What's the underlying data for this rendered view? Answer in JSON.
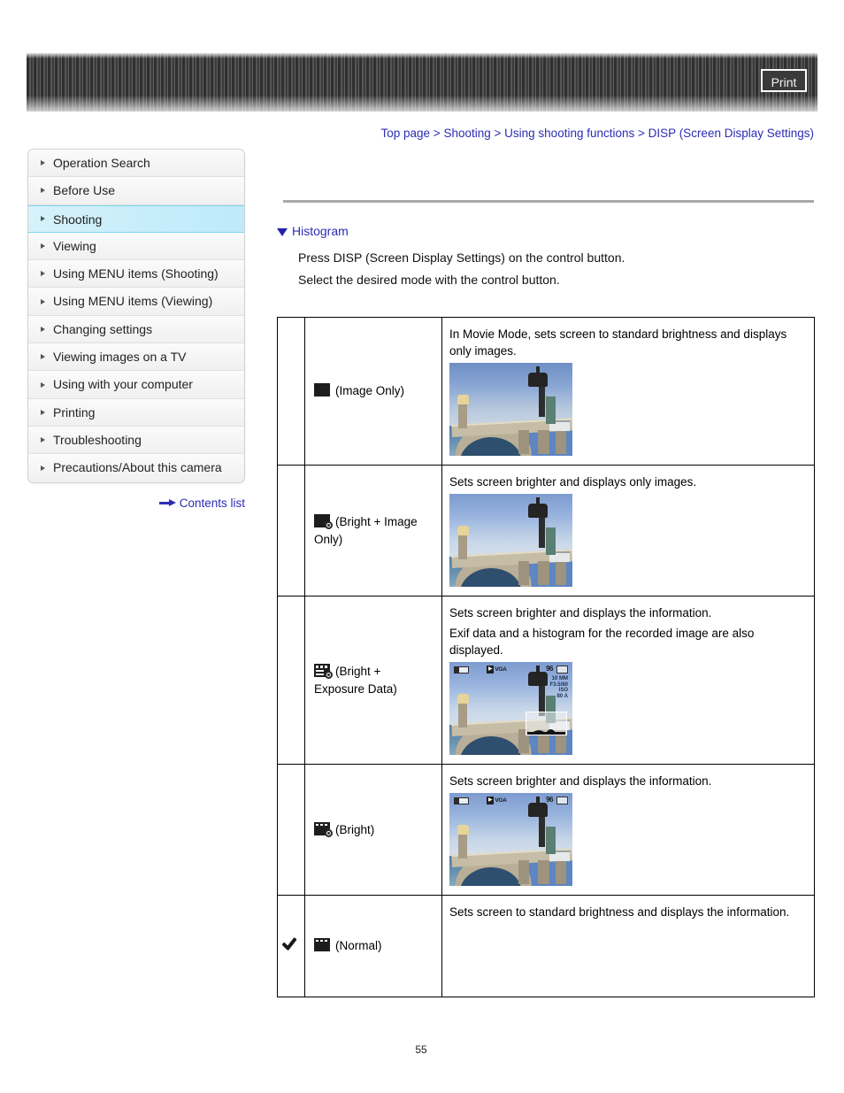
{
  "header": {
    "print_label": "Print"
  },
  "breadcrumb": {
    "items": [
      "Top page",
      "Shooting",
      "Using shooting functions",
      "DISP (Screen Display Settings)"
    ],
    "separator": ">"
  },
  "sidebar": {
    "items": [
      {
        "label": "Operation Search",
        "active": false
      },
      {
        "label": "Before Use",
        "active": false
      },
      {
        "label": "Shooting",
        "active": true
      },
      {
        "label": "Viewing",
        "active": false
      },
      {
        "label": "Using MENU items (Shooting)",
        "active": false
      },
      {
        "label": "Using MENU items (Viewing)",
        "active": false
      },
      {
        "label": "Changing settings",
        "active": false
      },
      {
        "label": "Viewing images on a TV",
        "active": false
      },
      {
        "label": "Using with your computer",
        "active": false
      },
      {
        "label": "Printing",
        "active": false
      },
      {
        "label": "Troubleshooting",
        "active": false
      },
      {
        "label": "Precautions/About this camera",
        "active": false
      }
    ],
    "contents_list_label": "Contents list"
  },
  "main": {
    "section_title": "Histogram",
    "instruction_1": "Press DISP (Screen Display Settings) on the control button.",
    "instruction_2": "Select the desired mode with the control button.",
    "rows": [
      {
        "checked": "",
        "mode_label": "(Image Only)",
        "icon": "screen-plain-icon",
        "description_lines": [
          "In Movie Mode, sets screen to standard brightness and displays only images."
        ],
        "photo": {
          "bright": false,
          "overlay": false,
          "histogram": false
        }
      },
      {
        "checked": "",
        "mode_label": "(Bright + Image Only)",
        "icon": "screen-plain-bright-icon",
        "description_lines": [
          "Sets screen brighter and displays only images."
        ],
        "photo": {
          "bright": true,
          "overlay": false,
          "histogram": false
        }
      },
      {
        "checked": "",
        "mode_label": "(Bright + Exposure Data)",
        "icon": "screen-data-bright-icon",
        "description_lines": [
          "Sets screen brighter and displays the information.",
          "Exif data and a histogram for the recorded image are also displayed."
        ],
        "photo": {
          "bright": true,
          "overlay": true,
          "histogram": true
        }
      },
      {
        "checked": "",
        "mode_label": "(Bright)",
        "icon": "screen-info-bright-icon",
        "description_lines": [
          "Sets screen brighter and displays the information."
        ],
        "photo": {
          "bright": true,
          "overlay": true,
          "histogram": false
        }
      },
      {
        "checked": "✓",
        "mode_label": "(Normal)",
        "icon": "screen-info-icon",
        "description_lines": [
          "Sets screen to standard brightness and displays the information."
        ],
        "photo": null
      }
    ],
    "photo_overlay": {
      "vga_box": "▶",
      "vga_label": "VGA",
      "count": "96",
      "exif_lines": [
        "10 MM",
        "F3.5/60",
        "ISO",
        "80 A"
      ]
    }
  },
  "footer": {
    "page_number": "55"
  },
  "colors": {
    "link": "#2d2db5",
    "active_nav": "#c7edfa",
    "banner": "#3a3a3a"
  }
}
